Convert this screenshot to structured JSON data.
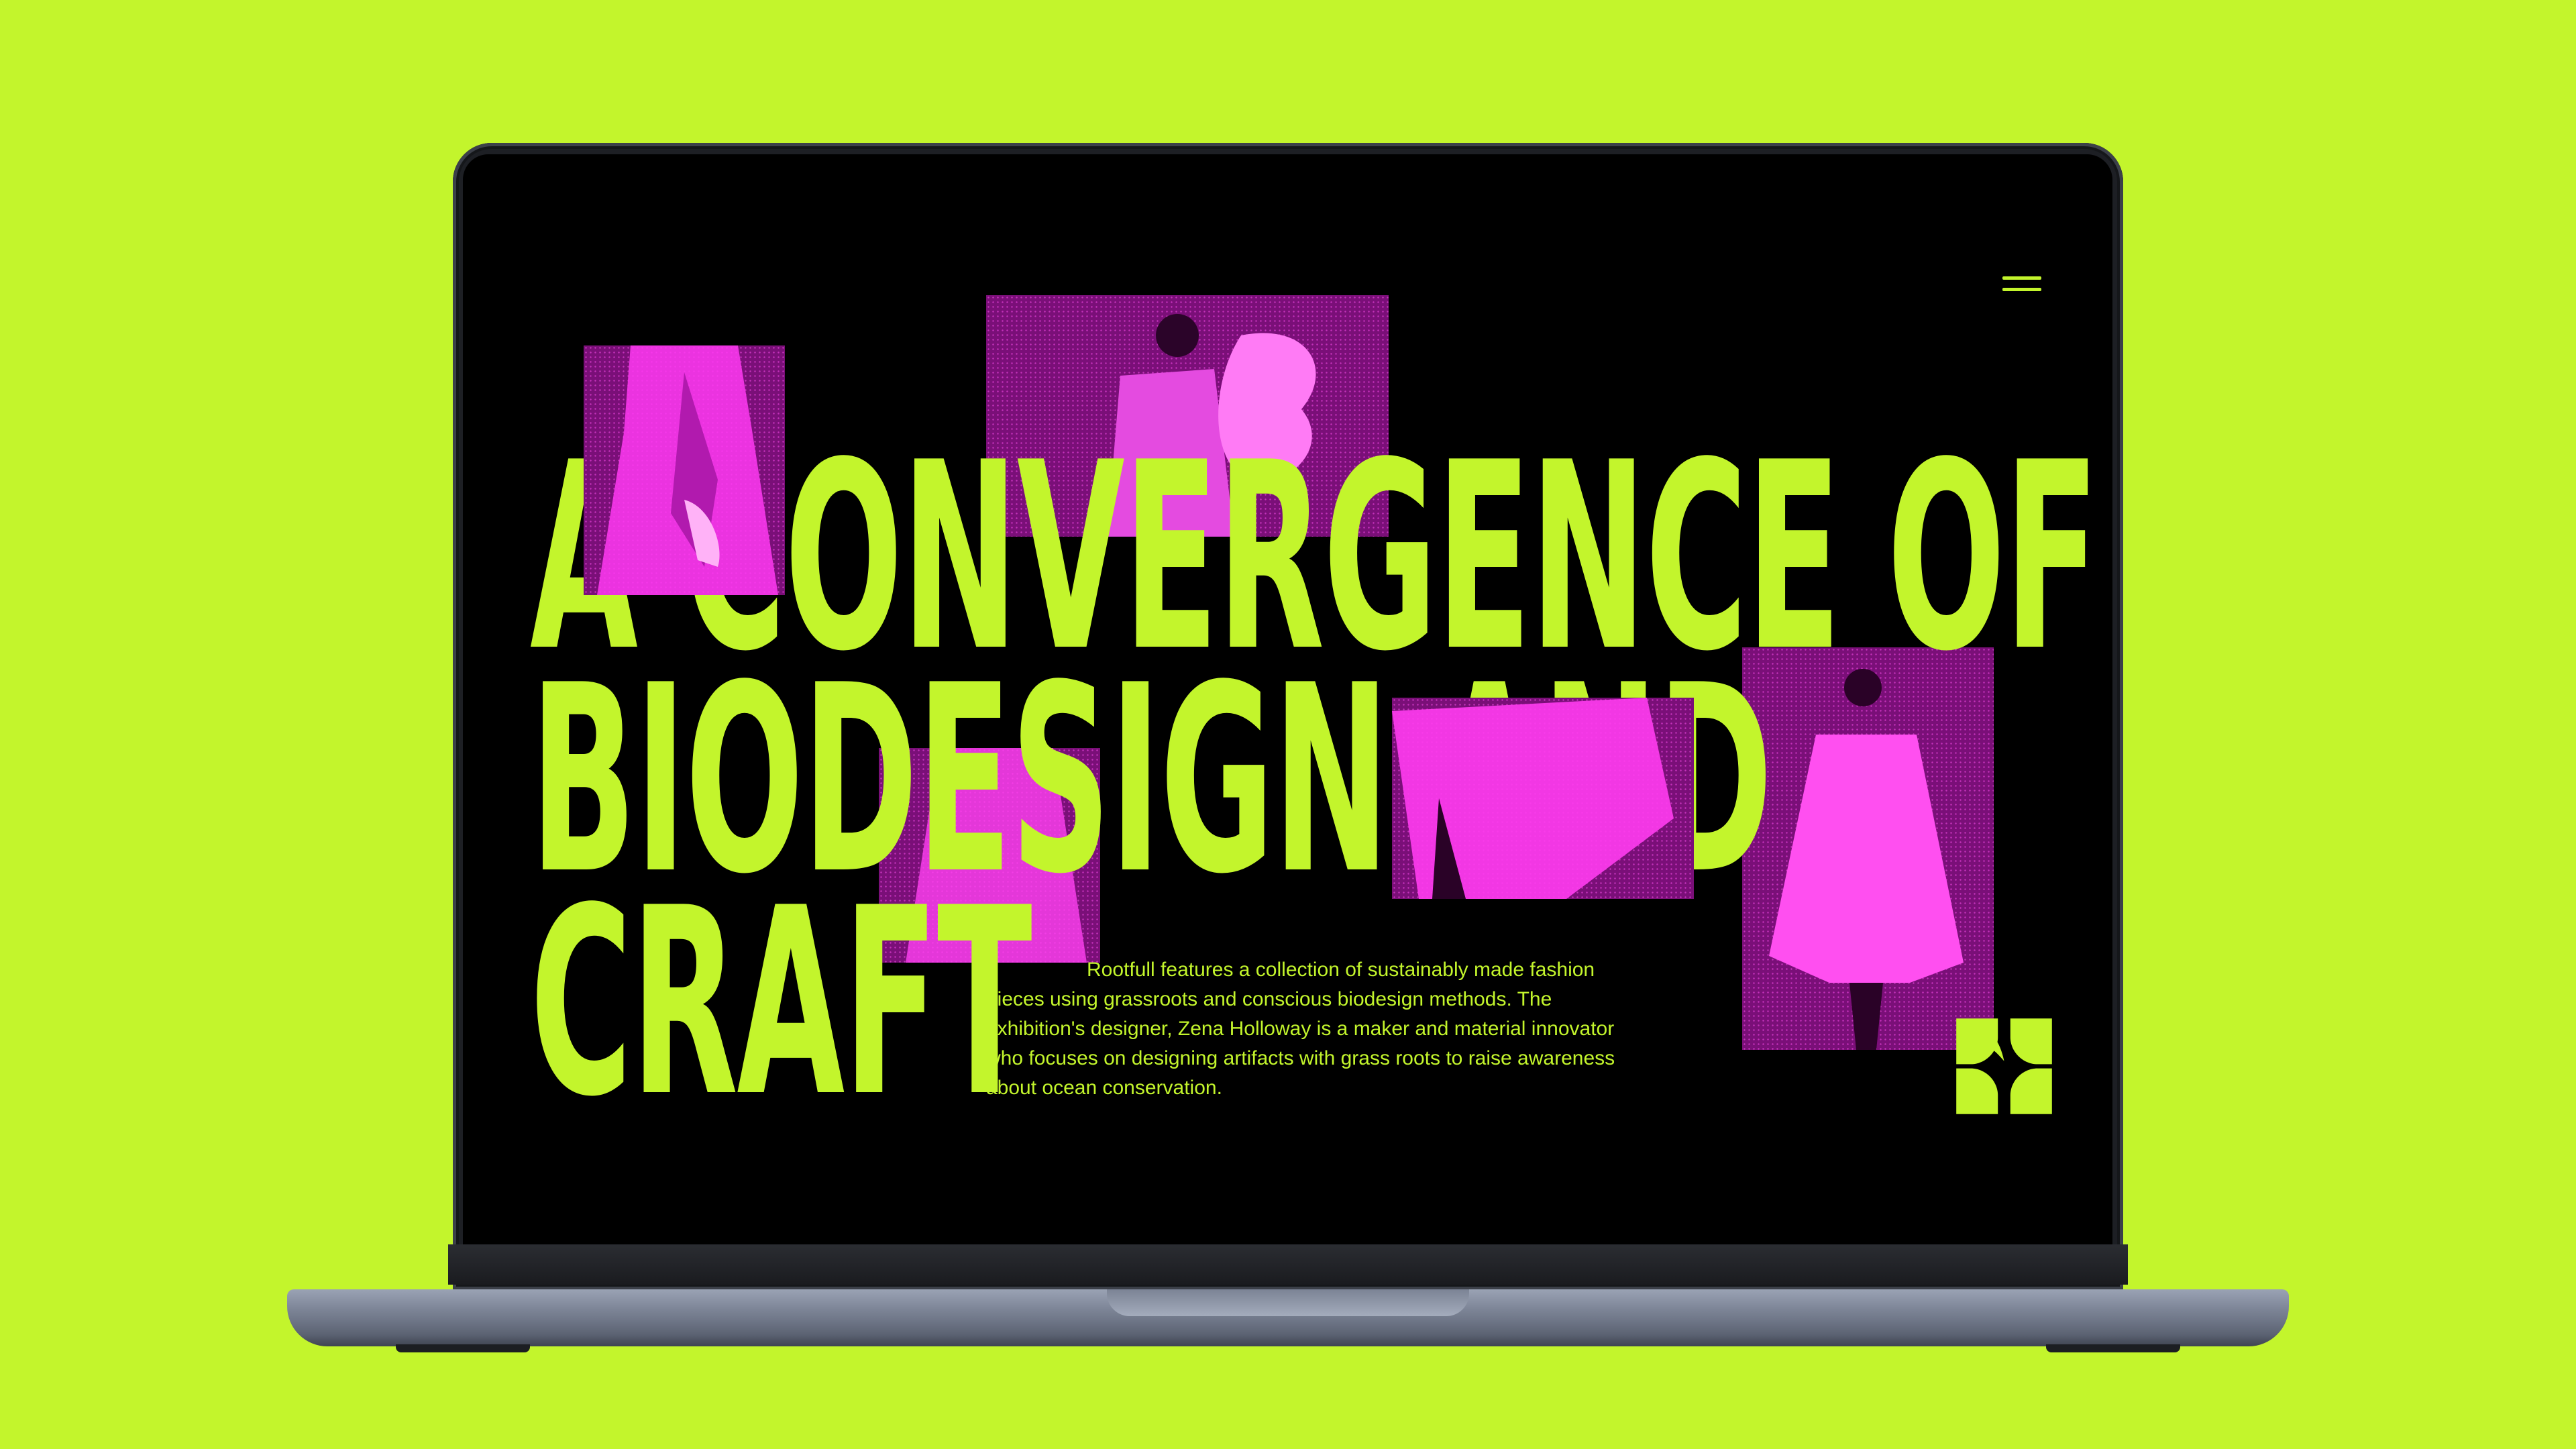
{
  "hero": {
    "headline_line1": "A CONVERGENCE OF",
    "headline_line2": "BIODESIGN AND",
    "headline_line3": "CRAFT",
    "intro": "Rootfull features a collection of sustainably made fashion pieces using grassroots and conscious biodesign methods. The exhibition's designer, Zena Holloway is a maker and material innovator who focuses on designing artifacts with grass roots to raise awareness about ocean conservation."
  },
  "nav": {
    "menu_icon": "hamburger-icon"
  },
  "brand": {
    "logo_icon": "clover-logo-icon"
  },
  "colors": {
    "background": "#c3f52c",
    "accent": "#c3f52c",
    "screen": "#000000",
    "photo_tint": "#d91ad4"
  }
}
